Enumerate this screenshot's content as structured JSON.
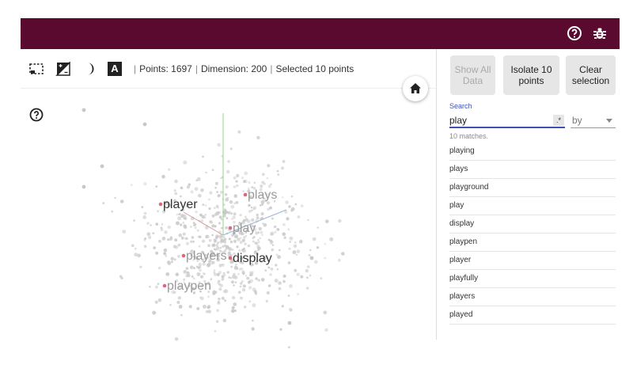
{
  "header": {
    "help_icon": "help-circle-icon",
    "bug_icon": "bug-icon",
    "color": "#5a0a2e"
  },
  "toolbar": {
    "icons": [
      "bounding-box-select-icon",
      "contrast-icon",
      "night-mode-icon",
      "label-text-icon"
    ],
    "label_icon_letter": "A",
    "points": "Points: 1697",
    "dimension": "Dimension: 200",
    "selected": "Selected 10 points",
    "separator": "|"
  },
  "canvas": {
    "home_icon": "home-icon",
    "help_icon": "help-circle-icon",
    "labels": [
      {
        "text": "player",
        "tone": "dark"
      },
      {
        "text": "plays",
        "tone": "light"
      },
      {
        "text": "play",
        "tone": "light"
      },
      {
        "text": "players",
        "tone": "light"
      },
      {
        "text": "display",
        "tone": "dark"
      },
      {
        "text": "playpen",
        "tone": "light"
      }
    ],
    "axis_colors": {
      "x": "#d7a0a0",
      "y": "#8fd68f",
      "z": "#9ab6d6"
    },
    "point_color": "#c8c8c8",
    "selected_color": "#e0667a"
  },
  "panel": {
    "buttons": {
      "show_all": "Show All Data",
      "isolate": "Isolate 10 points",
      "clear": "Clear selection"
    },
    "search": {
      "label": "Search",
      "value": "play",
      "regex": ".*",
      "by": "by",
      "matches": "10 matches."
    },
    "results": [
      "playing",
      "plays",
      "playground",
      "play",
      "display",
      "playpen",
      "player",
      "playfully",
      "players",
      "played"
    ]
  }
}
